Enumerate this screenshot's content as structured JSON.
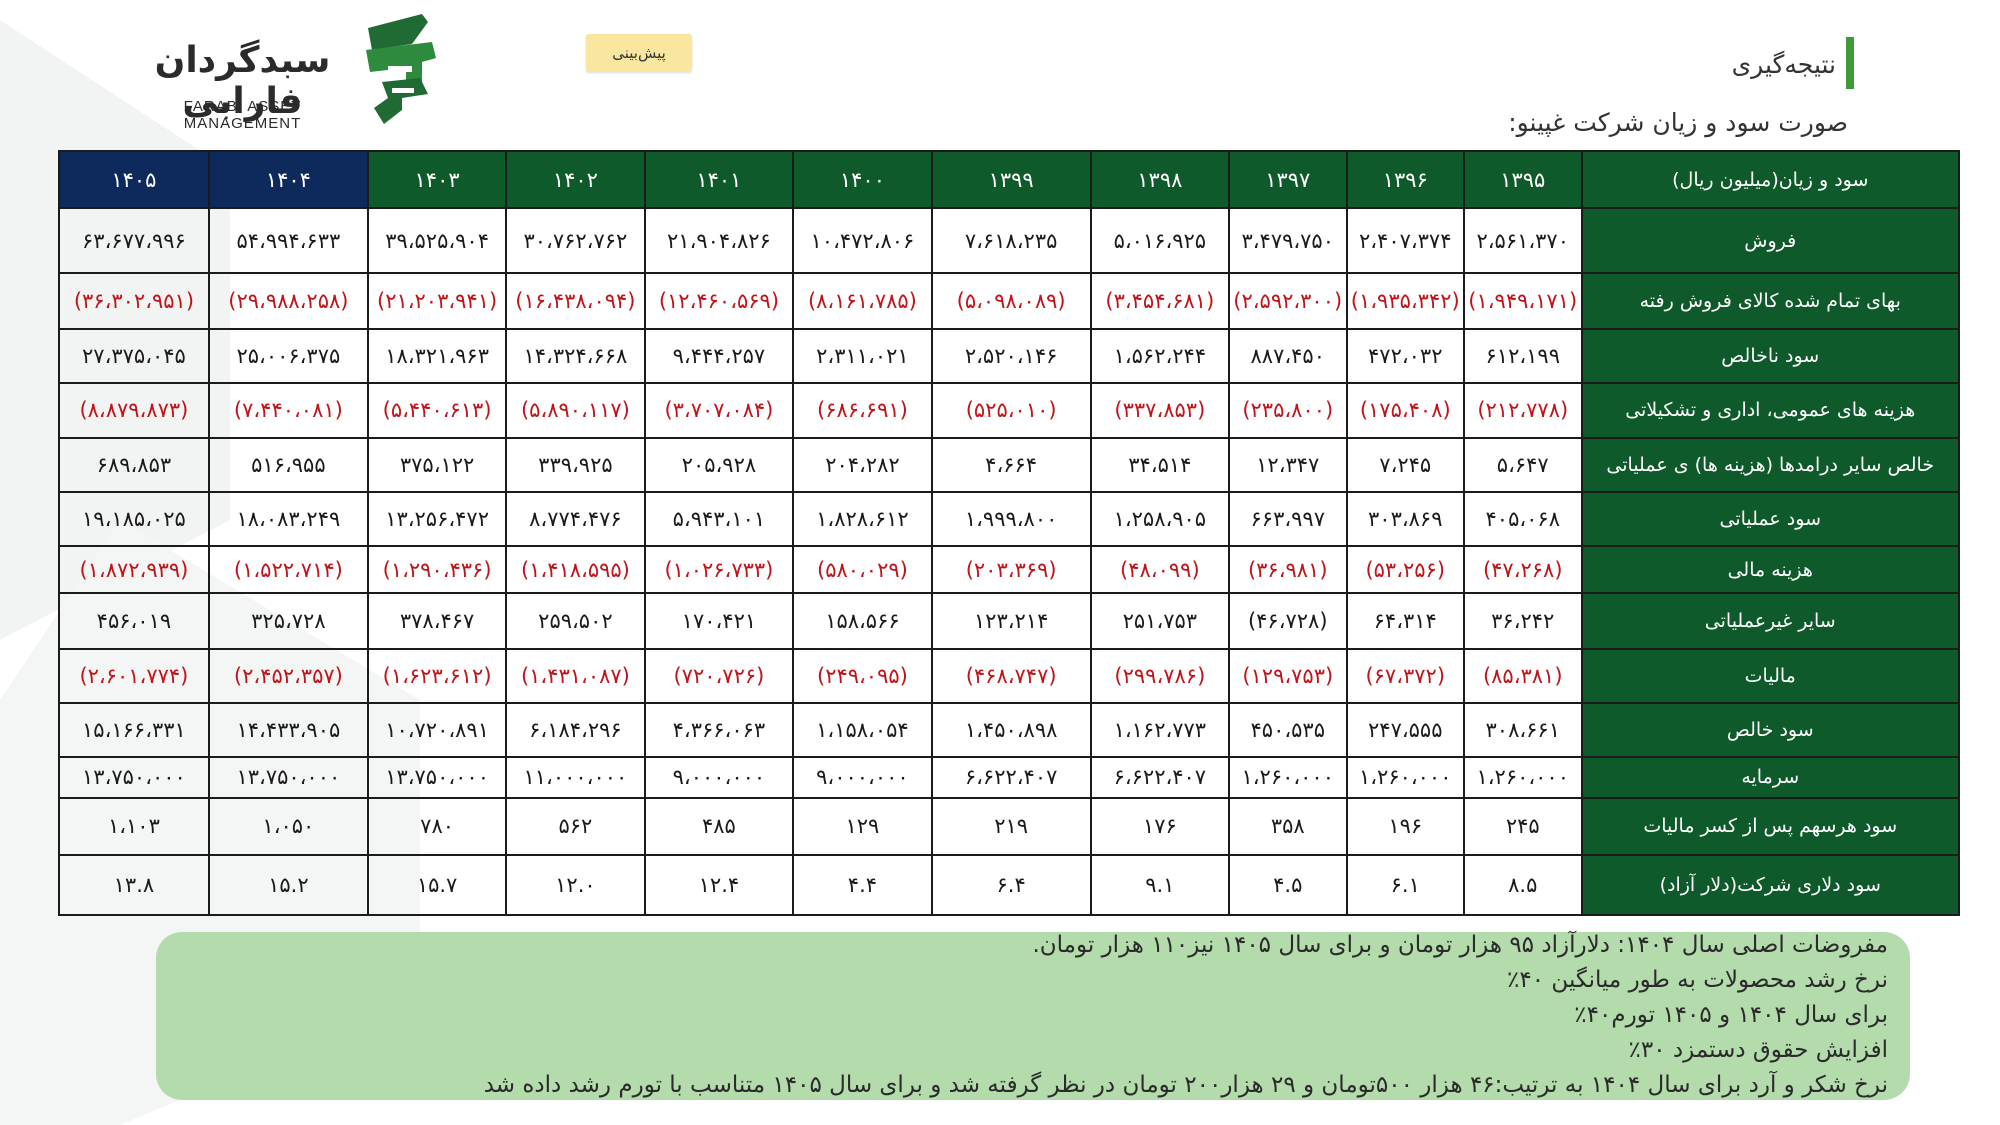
{
  "header": {
    "logo_fa": "سبدگردان فارابی",
    "logo_en": "FARABI ASSET MANAGEMENT",
    "forecast_tag": "پیش‌بینی",
    "title": "نتیجه‌گیری",
    "subtitle": "صورت سود و زیان شرکت غپینو:"
  },
  "colors": {
    "green": "#0f5a2b",
    "navy": "#0e2a5c",
    "negative": "#c0141a",
    "notes_bg": "#acd8a5"
  },
  "table": {
    "corner": "سود و زیان(میلیون ریال)",
    "years": [
      "۱۳۹۵",
      "۱۳۹۶",
      "۱۳۹۷",
      "۱۳۹۸",
      "۱۳۹۹",
      "۱۴۰۰",
      "۱۴۰۱",
      "۱۴۰۲",
      "۱۴۰۳",
      "۱۴۰۴",
      "۱۴۰۵"
    ],
    "rows": [
      {
        "label": "فروش",
        "neg": false,
        "values": [
          "۲،۵۶۱،۳۷۰",
          "۲،۴۰۷،۳۷۴",
          "۳،۴۷۹،۷۵۰",
          "۵،۰۱۶،۹۲۵",
          "۷،۶۱۸،۲۳۵",
          "۱۰،۴۷۲،۸۰۶",
          "۲۱،۹۰۴،۸۲۶",
          "۳۰،۷۶۲،۷۶۲",
          "۳۹،۵۲۵،۹۰۴",
          "۵۴،۹۹۴،۶۳۳",
          "۶۳،۶۷۷،۹۹۶"
        ]
      },
      {
        "label": "بهای تمام شده کالای فروش رفته",
        "neg": true,
        "values": [
          "(۱،۹۴۹،۱۷۱)",
          "(۱،۹۳۵،۳۴۲)",
          "(۲،۵۹۲،۳۰۰)",
          "(۳،۴۵۴،۶۸۱)",
          "(۵،۰۹۸،۰۸۹)",
          "(۸،۱۶۱،۷۸۵)",
          "(۱۲،۴۶۰،۵۶۹)",
          "(۱۶،۴۳۸،۰۹۴)",
          "(۲۱،۲۰۳،۹۴۱)",
          "(۲۹،۹۸۸،۲۵۸)",
          "(۳۶،۳۰۲،۹۵۱)"
        ]
      },
      {
        "label": "سود ناخالص",
        "neg": false,
        "values": [
          "۶۱۲،۱۹۹",
          "۴۷۲،۰۳۲",
          "۸۸۷،۴۵۰",
          "۱،۵۶۲،۲۴۴",
          "۲،۵۲۰،۱۴۶",
          "۲،۳۱۱،۰۲۱",
          "۹،۴۴۴،۲۵۷",
          "۱۴،۳۲۴،۶۶۸",
          "۱۸،۳۲۱،۹۶۳",
          "۲۵،۰۰۶،۳۷۵",
          "۲۷،۳۷۵،۰۴۵"
        ]
      },
      {
        "label": "هزینه های عمومی، اداری و تشکیلاتی",
        "neg": true,
        "values": [
          "(۲۱۲،۷۷۸)",
          "(۱۷۵،۴۰۸)",
          "(۲۳۵،۸۰۰)",
          "(۳۳۷،۸۵۳)",
          "(۵۲۵،۰۱۰)",
          "(۶۸۶،۶۹۱)",
          "(۳،۷۰۷،۰۸۴)",
          "(۵،۸۹۰،۱۱۷)",
          "(۵،۴۴۰،۶۱۳)",
          "(۷،۴۴۰،۰۸۱)",
          "(۸،۸۷۹،۸۷۳)"
        ]
      },
      {
        "label": "خالص سایر درامدها (هزینه ها) ی عملیاتی",
        "neg": false,
        "values": [
          "۵،۶۴۷",
          "۷،۲۴۵",
          "۱۲،۳۴۷",
          "۳۴،۵۱۴",
          "۴،۶۶۴",
          "۲۰۴،۲۸۲",
          "۲۰۵،۹۲۸",
          "۳۳۹،۹۲۵",
          "۳۷۵،۱۲۲",
          "۵۱۶،۹۵۵",
          "۶۸۹،۸۵۳"
        ]
      },
      {
        "label": "سود عملیاتی",
        "neg": false,
        "values": [
          "۴۰۵،۰۶۸",
          "۳۰۳،۸۶۹",
          "۶۶۳،۹۹۷",
          "۱،۲۵۸،۹۰۵",
          "۱،۹۹۹،۸۰۰",
          "۱،۸۲۸،۶۱۲",
          "۵،۹۴۳،۱۰۱",
          "۸،۷۷۴،۴۷۶",
          "۱۳،۲۵۶،۴۷۲",
          "۱۸،۰۸۳،۲۴۹",
          "۱۹،۱۸۵،۰۲۵"
        ]
      },
      {
        "label": "هزینه مالی",
        "neg": true,
        "values": [
          "(۴۷،۲۶۸)",
          "(۵۳،۲۵۶)",
          "(۳۶،۹۸۱)",
          "(۴۸،۰۹۹)",
          "(۲۰۳،۳۶۹)",
          "(۵۸۰،۰۲۹)",
          "(۱،۰۲۶،۷۳۳)",
          "(۱،۴۱۸،۵۹۵)",
          "(۱،۲۹۰،۴۳۶)",
          "(۱،۵۲۲،۷۱۴)",
          "(۱،۸۷۲،۹۳۹)"
        ]
      },
      {
        "label": "سایر غیرعملیاتی",
        "neg": false,
        "values": [
          "۳۶،۲۴۲",
          "۶۴،۳۱۴",
          "(۴۶،۷۲۸)",
          "۲۵۱،۷۵۳",
          "۱۲۳،۲۱۴",
          "۱۵۸،۵۶۶",
          "۱۷۰،۴۲۱",
          "۲۵۹،۵۰۲",
          "۳۷۸،۴۶۷",
          "۳۲۵،۷۲۸",
          "۴۵۶،۰۱۹"
        ]
      },
      {
        "label": "مالیات",
        "neg": true,
        "values": [
          "(۸۵،۳۸۱)",
          "(۶۷،۳۷۲)",
          "(۱۲۹،۷۵۳)",
          "(۲۹۹،۷۸۶)",
          "(۴۶۸،۷۴۷)",
          "(۲۴۹،۰۹۵)",
          "(۷۲۰،۷۲۶)",
          "(۱،۴۳۱،۰۸۷)",
          "(۱،۶۲۳،۶۱۲)",
          "(۲،۴۵۲،۳۵۷)",
          "(۲،۶۰۱،۷۷۴)"
        ]
      },
      {
        "label": "سود خالص",
        "neg": false,
        "values": [
          "۳۰۸،۶۶۱",
          "۲۴۷،۵۵۵",
          "۴۵۰،۵۳۵",
          "۱،۱۶۲،۷۷۳",
          "۱،۴۵۰،۸۹۸",
          "۱،۱۵۸،۰۵۴",
          "۴،۳۶۶،۰۶۳",
          "۶،۱۸۴،۲۹۶",
          "۱۰،۷۲۰،۸۹۱",
          "۱۴،۴۳۳،۹۰۵",
          "۱۵،۱۶۶،۳۳۱"
        ]
      },
      {
        "label": "سرمایه",
        "neg": false,
        "values": [
          "۱،۲۶۰،۰۰۰",
          "۱،۲۶۰،۰۰۰",
          "۱،۲۶۰،۰۰۰",
          "۶،۶۲۲،۴۰۷",
          "۶،۶۲۲،۴۰۷",
          "۹،۰۰۰،۰۰۰",
          "۹،۰۰۰،۰۰۰",
          "۱۱،۰۰۰،۰۰۰",
          "۱۳،۷۵۰،۰۰۰",
          "۱۳،۷۵۰،۰۰۰",
          "۱۳،۷۵۰،۰۰۰"
        ]
      },
      {
        "label": "سود هرسهم پس از کسر مالیات",
        "neg": false,
        "values": [
          "۲۴۵",
          "۱۹۶",
          "۳۵۸",
          "۱۷۶",
          "۲۱۹",
          "۱۲۹",
          "۴۸۵",
          "۵۶۲",
          "۷۸۰",
          "۱،۰۵۰",
          "۱،۱۰۳"
        ]
      },
      {
        "label": "سود دلاری شرکت(دلار آزاد)",
        "neg": false,
        "values": [
          "۸.۵",
          "۶.۱",
          "۴.۵",
          "۹.۱",
          "۶.۴",
          "۴.۴",
          "۱۲.۴",
          "۱۲.۰",
          "۱۵.۷",
          "۱۵.۲",
          "۱۳.۸"
        ]
      }
    ]
  },
  "notes": [
    "مفروضات اصلی سال ۱۴۰۴: دلارآزاد ۹۵ هزار تومان و برای سال ۱۴۰۵ نیز۱۱۰ هزار تومان.",
    "نرخ رشد محصولات به طور میانگین ۴۰٪",
    "برای سال ۱۴۰۴ و ۱۴۰۵ تورم۴۰٪",
    "افزایش حقوق دستمزد ۳۰٪",
    "نرخ شکر و آرد برای سال ۱۴۰۴ به ترتیب:۴۶ هزار ۵۰۰تومان و ۲۹ هزار۲۰۰ تومان در نظر گرفته شد و برای سال ۱۴۰۵ متناسب با تورم رشد داده شد"
  ]
}
